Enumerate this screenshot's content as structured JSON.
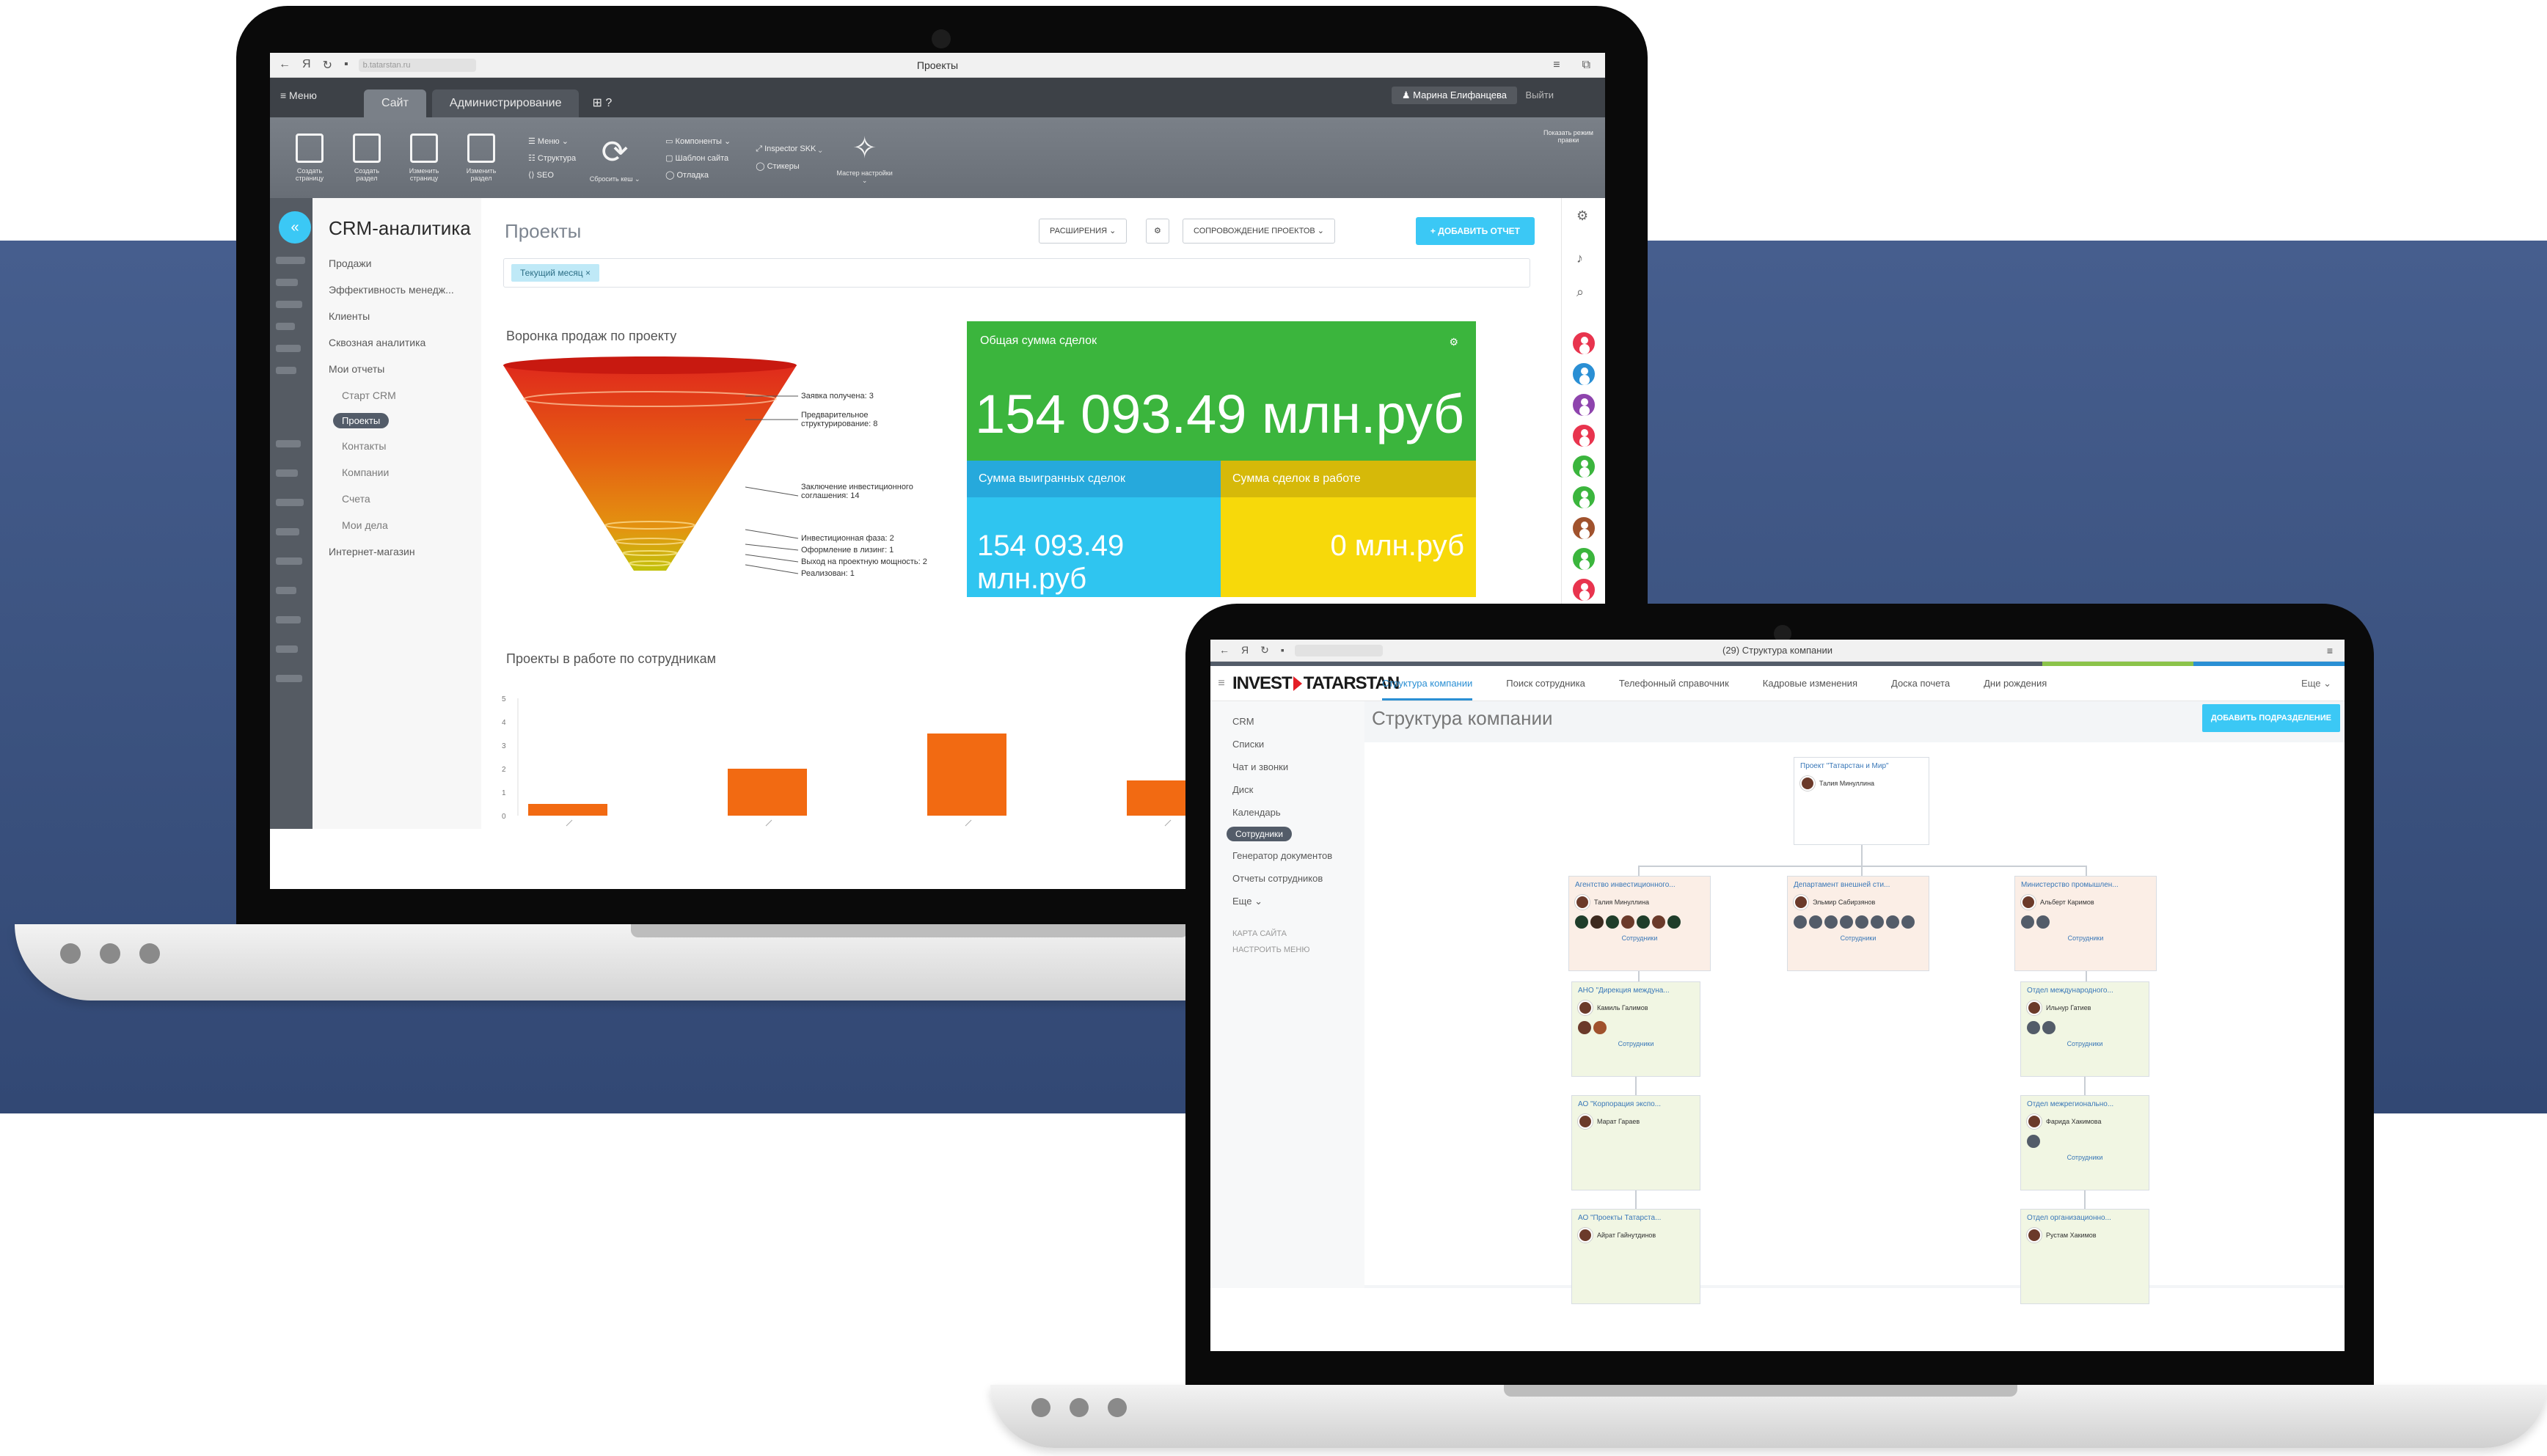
{
  "colors": {
    "band": "#3b527f",
    "accent_blue": "#3bc8f5",
    "funnel_top": "#d9201e",
    "funnel_bottom": "#e6a50a",
    "card_green": "#3bb53d",
    "card_blue": "#2fc5f0",
    "card_yellow": "#f7d90a",
    "bar_orange": "#f26a12",
    "logo_red": "#e41e26"
  },
  "laptop1": {
    "browser": {
      "title": "Проекты",
      "url": "b.tatarstan.ru"
    },
    "menu_label": "≡ Меню",
    "tabs": [
      "Сайт",
      "Администрирование"
    ],
    "tab_extra": "⊞ ?",
    "user_label": "♟ Марина Елифанцева",
    "exit_label": "Выйти",
    "ribbon": {
      "buttons": [
        "Создать страницу",
        "Создать раздел",
        "Изменить страницу",
        "Изменить раздел"
      ],
      "group1": [
        "☰ Меню ⌄",
        "☷ Структура",
        "⟨⟩ SEO"
      ],
      "refresh_label": "Сбросить кеш ⌄",
      "group2": [
        "▭ Компоненты ⌄",
        "▢ Шаблон сайта",
        "◯ Отладка"
      ],
      "group3": [
        "⤢ Inspector SKK ⌄",
        "◯ Стикеры"
      ],
      "wand_label": "Мастер настройки ⌄",
      "right_label": "Показать режим правки"
    },
    "crm": {
      "title": "CRM-аналитика",
      "sidebar": [
        {
          "label": "Продажи",
          "level": 0
        },
        {
          "label": "Эффективность менедж...",
          "level": 0
        },
        {
          "label": "Клиенты",
          "level": 0
        },
        {
          "label": "Сквозная аналитика",
          "level": 0
        },
        {
          "label": "Мои отчеты",
          "level": 0
        },
        {
          "label": "Старт CRM",
          "level": 1
        }
      ],
      "sidebar_selected": "Проекты",
      "sidebar_after": [
        {
          "label": "Контакты",
          "level": 1
        },
        {
          "label": "Компании",
          "level": 1
        },
        {
          "label": "Счета",
          "level": 1
        },
        {
          "label": "Мои дела",
          "level": 1
        },
        {
          "label": "Интернет-магазин",
          "level": 0
        }
      ],
      "page_title": "Проекты",
      "btn_extensions": "РАСШИРЕНИЯ ⌄",
      "btn_gear": "⚙",
      "btn_support": "СОПРОВОЖДЕНИЕ ПРОЕКТОВ ⌄",
      "btn_add": "+ ДОБАВИТЬ ОТЧЕТ",
      "filter_chip": "Текущий месяц ×"
    },
    "funnel_chart": {
      "title": "Воронка продаж по проекту",
      "stages": [
        {
          "label": "Заявка получена: 3"
        },
        {
          "label": "Предварительное структурирование: 8"
        },
        {
          "label": "Заключение инвестиционного соглашения: 14"
        },
        {
          "label": "Инвестиционная фаза: 2"
        },
        {
          "label": "Оформление в лизинг: 1"
        },
        {
          "label": "Выход на проектную мощность: 2"
        },
        {
          "label": "Реализован: 1"
        }
      ]
    },
    "card_total": {
      "title": "Общая сумма сделок",
      "value": "154 093.49 млн.руб"
    },
    "card_won": {
      "title": "Сумма выигранных сделок",
      "value": "154 093.49 млн.руб"
    },
    "card_in_work": {
      "title": "Сумма сделок в работе",
      "value": "0 млн.руб"
    }
  },
  "chart_data": {
    "type": "bar",
    "title": "Проекты в работе по сотрудникам",
    "ylim": [
      0,
      5
    ],
    "yticks": [
      "5",
      "4",
      "3",
      "2",
      "1",
      "0"
    ],
    "values": [
      0.5,
      2,
      3.5,
      1.5
    ],
    "grid": false
  },
  "laptop2": {
    "browser": {
      "title": "(29) Структура компании"
    },
    "logo": {
      "left": "INVEST",
      "right": "TATARSTAN"
    },
    "nav": [
      "Структура компании",
      "Поиск сотрудника",
      "Телефонный справочник",
      "Кадровые изменения",
      "Доска почета",
      "Дни рождения"
    ],
    "more": "Еще ⌄",
    "sidebar": [
      "CRM",
      "Списки",
      "Чат и звонки",
      "Диск",
      "Календарь"
    ],
    "sidebar_selected": "Сотрудники",
    "sidebar_after": [
      "Генератор документов",
      "Отчеты сотрудников",
      "Еще ⌄"
    ],
    "sidebar_small": [
      "КАРТА САЙТА",
      "НАСТРОИТЬ МЕНЮ"
    ],
    "page_title": "Структура компании",
    "add_btn": "ДОБАВИТЬ ПОДРАЗДЕЛЕНИЕ",
    "org": {
      "root": {
        "title": "Проект \"Татарстан и Мир\"",
        "person": "Талия Минуллина"
      },
      "level1": [
        {
          "title": "Агентство инвестиционного...",
          "person": "Талия Минуллина",
          "link": "Сотрудники"
        },
        {
          "title": "Департамент внешней сти...",
          "person": "Эльмир Сабирзянов",
          "link": "Сотрудники"
        },
        {
          "title": "Министерство промышлен...",
          "person": "Альберт Каримов",
          "link": "Сотрудники"
        }
      ],
      "left_col": [
        {
          "title": "АНО \"Дирекция междуна...",
          "person": "Камиль Галимов",
          "link": "Сотрудники"
        },
        {
          "title": "АО \"Корпорация экспо...",
          "person": "Марат Гараев"
        },
        {
          "title": "АО \"Проекты Татарста...",
          "person": "Айрат Гайнутдинов"
        }
      ],
      "right_col": [
        {
          "title": "Отдел международного...",
          "person": "Ильнур Гатиев",
          "link": "Сотрудники"
        },
        {
          "title": "Отдел межрегионально...",
          "person": "Фарида Хакимова",
          "link": "Сотрудники"
        },
        {
          "title": "Отдел организационно...",
          "person": "Рустам Хакимов"
        }
      ]
    }
  }
}
